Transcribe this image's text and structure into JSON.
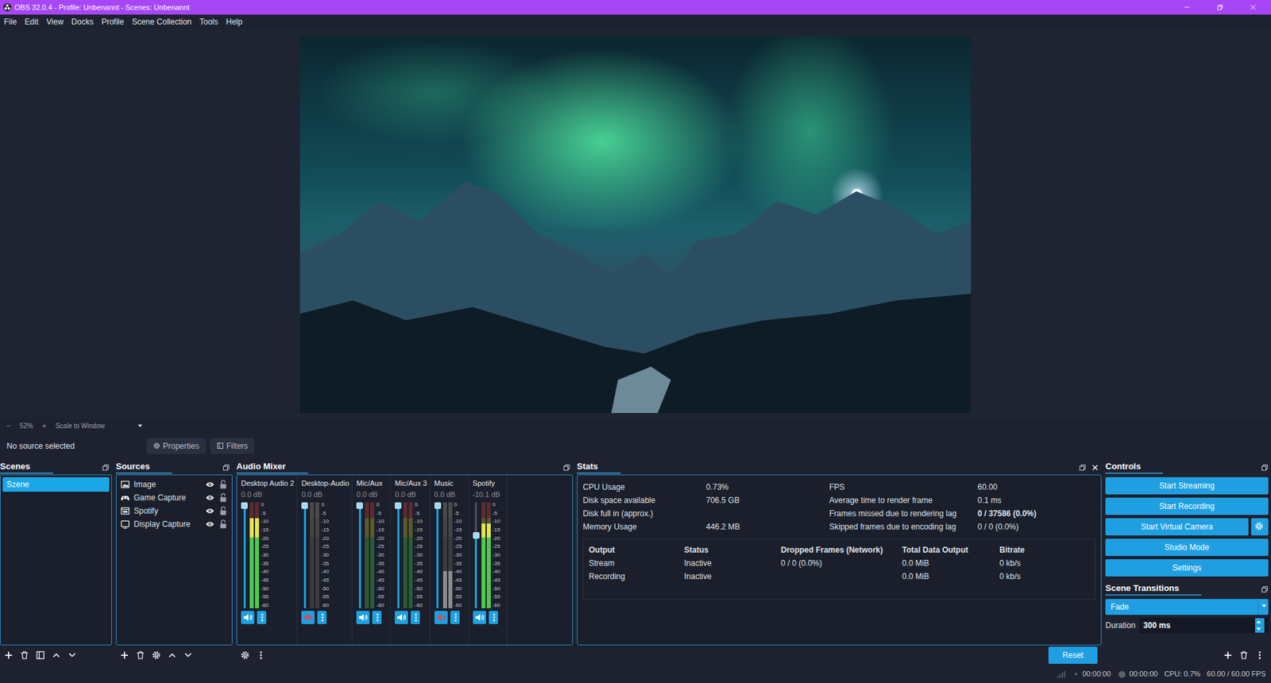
{
  "window": {
    "title": "OBS 32.0.4 - Profile: Unbenannt - Scenes: Unbenannt"
  },
  "menu": [
    "File",
    "Edit",
    "View",
    "Docks",
    "Profile",
    "Scene Collection",
    "Tools",
    "Help"
  ],
  "preview_bar": {
    "zoom_out": "−",
    "zoom": "52%",
    "zoom_in": "+",
    "scale": "Scale to Window"
  },
  "source_bar": {
    "label": "No source selected",
    "buttons": [
      {
        "label": "Properties",
        "kind": "gear"
      },
      {
        "label": "Filters",
        "kind": "filter"
      }
    ]
  },
  "scenes": {
    "title": "Scenes",
    "items": [
      {
        "label": "Szene",
        "selected": true
      }
    ]
  },
  "sources": {
    "title": "Sources",
    "items": [
      {
        "label": "Image",
        "kind": "image",
        "visible": true,
        "locked": false
      },
      {
        "label": "Game Capture",
        "kind": "game",
        "visible": true,
        "locked": false
      },
      {
        "label": "Spotify",
        "kind": "window",
        "visible": true,
        "locked": false
      },
      {
        "label": "Display Capture",
        "kind": "display",
        "visible": true,
        "locked": false
      }
    ]
  },
  "mixer": {
    "title": "Audio Mixer",
    "scale": [
      "0",
      "-5",
      "-10",
      "-15",
      "-20",
      "-25",
      "-30",
      "-35",
      "-40",
      "-45",
      "-50",
      "-55",
      "-60"
    ],
    "channels": [
      {
        "name": "Desktop Audio 2",
        "reading": "0.0 dB",
        "fader": 1,
        "level": 0.85,
        "muted": false
      },
      {
        "name": "Desktop-Audio",
        "reading": "0.0 dB",
        "fader": 1,
        "level": 0,
        "muted": true
      },
      {
        "name": "Mic/Aux",
        "reading": "0.0 dB",
        "fader": 1,
        "level": 0,
        "muted": false
      },
      {
        "name": "Mic/Aux 3",
        "reading": "0.0 dB",
        "fader": 1,
        "level": 0,
        "muted": false
      },
      {
        "name": "Music",
        "reading": "0.0 dB",
        "fader": 1,
        "level": 0.35,
        "muted": true
      },
      {
        "name": "Spotify",
        "reading": "-10.1 dB",
        "fader": 0.7,
        "level": 0.8,
        "muted": false
      }
    ]
  },
  "stats": {
    "title": "Stats",
    "left": [
      {
        "label": "CPU Usage",
        "value": "0.73%",
        "bold": false
      },
      {
        "label": "Disk space available",
        "value": "706.5 GB",
        "bold": false
      },
      {
        "label": "Disk full in (approx.)",
        "value": "",
        "bold": false
      },
      {
        "label": "Memory Usage",
        "value": "446.2 MB",
        "bold": false
      }
    ],
    "right": [
      {
        "label": "FPS",
        "value": "60.00",
        "bold": false
      },
      {
        "label": "Average time to render frame",
        "value": "0.1 ms",
        "bold": false
      },
      {
        "label": "Frames missed due to rendering lag",
        "value": "0 / 37586 (0.0%)",
        "bold": true
      },
      {
        "label": "Skipped frames due to encoding lag",
        "value": "0 / 0 (0.0%)",
        "bold": false
      }
    ],
    "columns": [
      "Output",
      "Status",
      "Dropped Frames (Network)",
      "Total Data Output",
      "Bitrate"
    ],
    "rows": [
      [
        "Stream",
        "Inactive",
        "0 / 0 (0.0%)",
        "0.0 MiB",
        "0 kb/s"
      ],
      [
        "Recording",
        "Inactive",
        "",
        "0.0 MiB",
        "0 kb/s"
      ]
    ],
    "reset": "Reset"
  },
  "controls": {
    "title": "Controls",
    "buttons": [
      {
        "label": "Start Streaming",
        "kind": "plain"
      },
      {
        "label": "Start Recording",
        "kind": "plain"
      },
      {
        "label": "Start Virtual Camera",
        "kind": "with-settings"
      },
      {
        "label": "Studio Mode",
        "kind": "plain"
      },
      {
        "label": "Settings",
        "kind": "plain"
      }
    ]
  },
  "transitions": {
    "title": "Scene Transitions",
    "selected": "Fade",
    "duration_label": "Duration",
    "duration": "300 ms"
  },
  "status_bar": {
    "stream_time": "00:00:00",
    "record_time": "00:00:00",
    "cpu": "CPU: 0.7%",
    "fps": "60.00 / 60.00 FPS"
  }
}
